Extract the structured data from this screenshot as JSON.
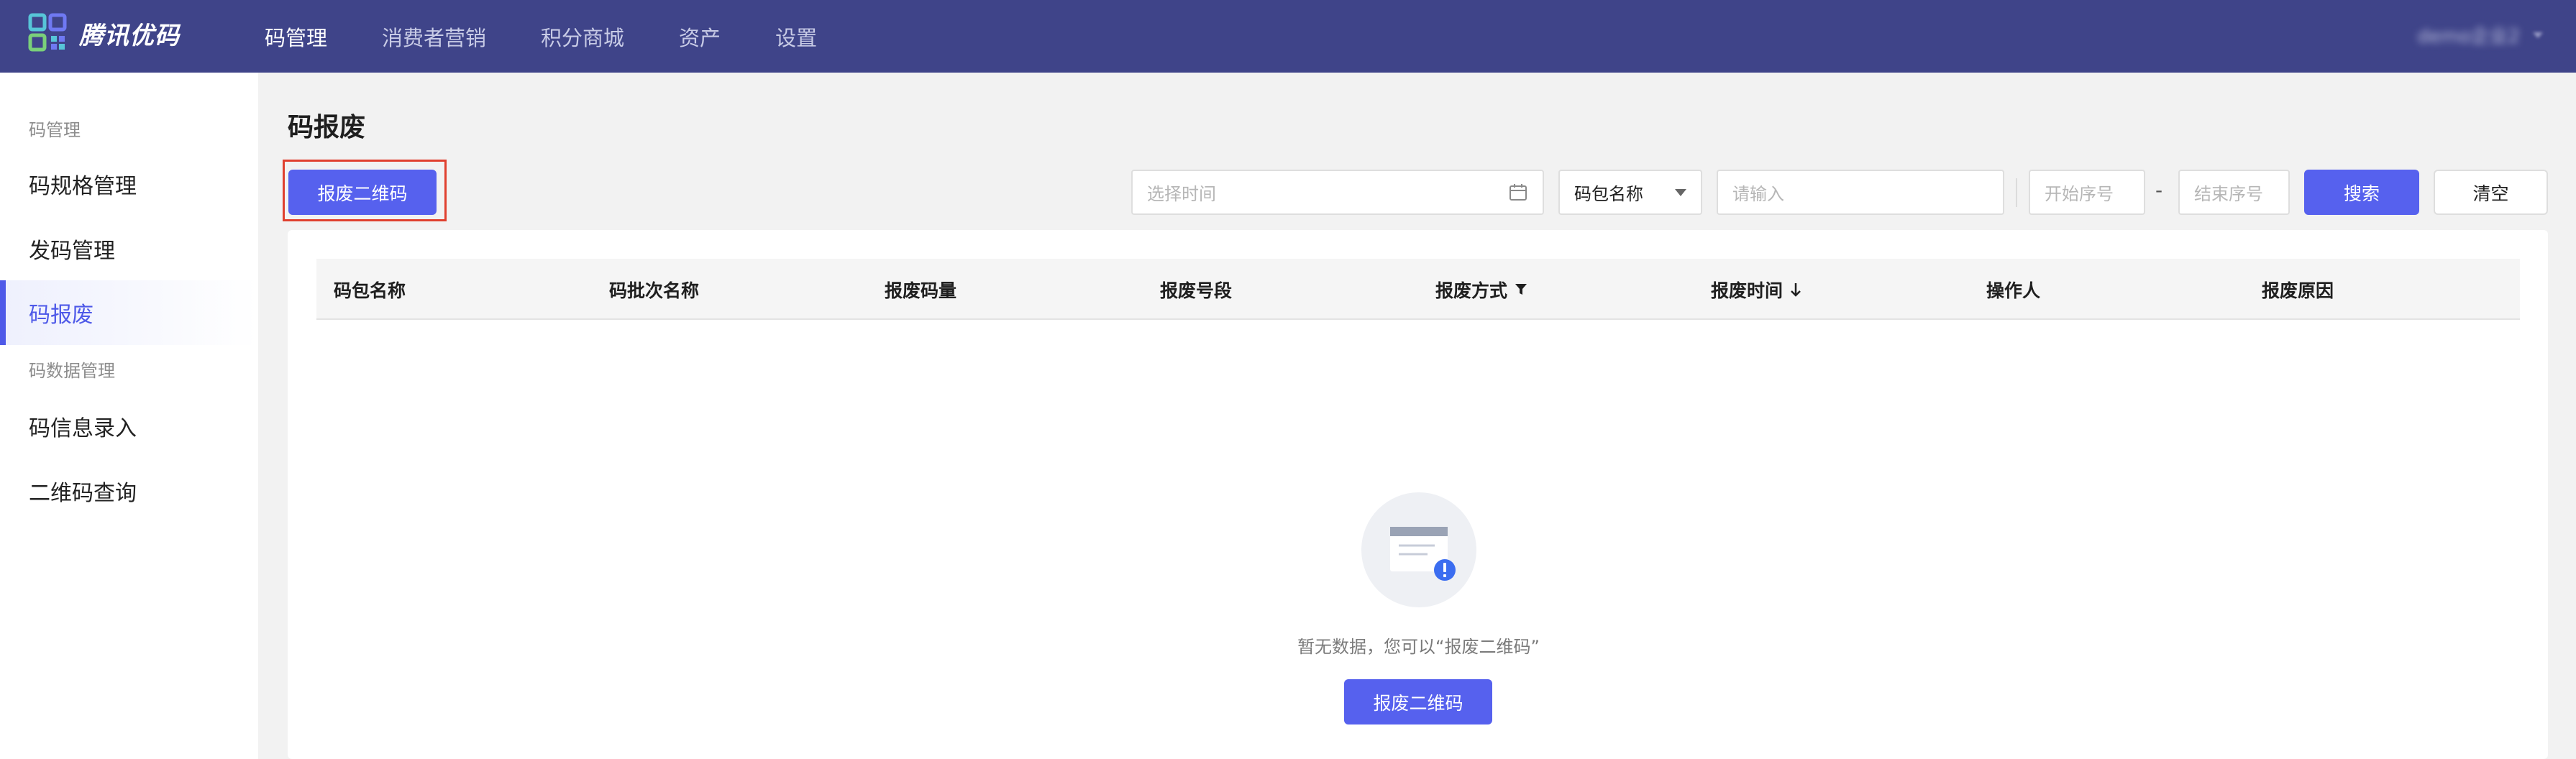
{
  "app": {
    "logo_text": "腾讯优码",
    "user_name": "demo企业2",
    "brand_color": "#3f4489",
    "accent_color": "#5661ee"
  },
  "nav": {
    "items": [
      {
        "label": "码管理",
        "active": true
      },
      {
        "label": "消费者营销",
        "active": false
      },
      {
        "label": "积分商城",
        "active": false
      },
      {
        "label": "资产",
        "active": false
      },
      {
        "label": "设置",
        "active": false
      }
    ]
  },
  "sidebar": {
    "group1": "码管理",
    "item_spec": "码规格管理",
    "item_issue": "发码管理",
    "item_scrap": "码报废",
    "group2": "码数据管理",
    "item_info": "码信息录入",
    "item_query": "二维码查询",
    "active_item": "码报废"
  },
  "page": {
    "title": "码报废",
    "scrap_button": "报废二维码"
  },
  "filters": {
    "time_placeholder": "选择时间",
    "package_select": "码包名称",
    "keyword_placeholder": "请输入",
    "start_placeholder": "开始序号",
    "separator": "-",
    "end_placeholder": "结束序号",
    "search_button": "搜索",
    "clear_button": "清空"
  },
  "table": {
    "columns": [
      {
        "label": "码包名称"
      },
      {
        "label": "码批次名称"
      },
      {
        "label": "报废码量"
      },
      {
        "label": "报废号段"
      },
      {
        "label": "报废方式",
        "icon": "filter-icon"
      },
      {
        "label": "报废时间",
        "icon": "sort-down-icon"
      },
      {
        "label": "操作人"
      },
      {
        "label": "报废原因"
      }
    ],
    "rows": []
  },
  "empty_state": {
    "icon": "empty-document-icon",
    "text": "暂无数据，您可以“报废二维码”",
    "button": "报废二维码"
  }
}
